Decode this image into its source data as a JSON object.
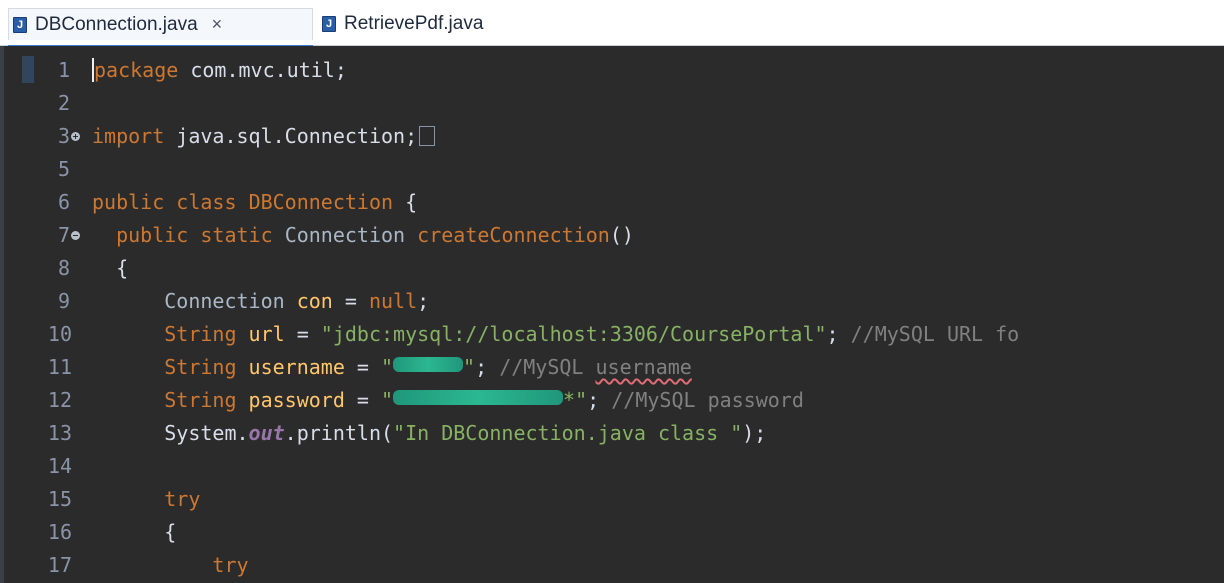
{
  "tabs": [
    {
      "label": "DBConnection.java",
      "icon": "java-file-icon",
      "active": true,
      "close": "×"
    },
    {
      "label": "RetrievePdf.java",
      "icon": "java-file-icon",
      "active": false
    }
  ],
  "editor": {
    "lines": [
      {
        "n": "1",
        "parts": [
          [
            "kw",
            "package"
          ],
          [
            "pln",
            " com.mvc.util;"
          ]
        ]
      },
      {
        "n": "2",
        "parts": []
      },
      {
        "n": "3",
        "fold": "plus",
        "parts": [
          [
            "kw",
            "import"
          ],
          [
            "pln",
            " java.sql.Connection;"
          ]
        ],
        "collapsed": true
      },
      {
        "n": "5",
        "parts": []
      },
      {
        "n": "6",
        "parts": [
          [
            "kw",
            "public"
          ],
          [
            "pln",
            " "
          ],
          [
            "kw",
            "class"
          ],
          [
            "pln",
            " "
          ],
          [
            "kw",
            "DBConnection"
          ],
          [
            "pln",
            " {"
          ]
        ]
      },
      {
        "n": "7",
        "fold": "minus",
        "parts": [
          [
            "pln",
            "  "
          ],
          [
            "kw",
            "public"
          ],
          [
            "pln",
            " "
          ],
          [
            "kw",
            "static"
          ],
          [
            "pln",
            " "
          ],
          [
            "cls",
            "Connection"
          ],
          [
            "pln",
            " "
          ],
          [
            "kw",
            "createConnection"
          ],
          [
            "pln",
            "()"
          ]
        ]
      },
      {
        "n": "8",
        "parts": [
          [
            "pln",
            "  {"
          ]
        ]
      },
      {
        "n": "9",
        "parts": [
          [
            "pln",
            "      "
          ],
          [
            "cls",
            "Connection"
          ],
          [
            "pln",
            " "
          ],
          [
            "ptr",
            "con"
          ],
          [
            "pln",
            " = "
          ],
          [
            "kw",
            "null"
          ],
          [
            "pln",
            ";"
          ]
        ]
      },
      {
        "n": "10",
        "parts": [
          [
            "pln",
            "      "
          ],
          [
            "kw",
            "String"
          ],
          [
            "pln",
            " "
          ],
          [
            "ptr",
            "url"
          ],
          [
            "pln",
            " = "
          ],
          [
            "str",
            "\"jdbc:mysql://localhost:3306/CoursePortal\""
          ],
          [
            "pln",
            "; "
          ],
          [
            "cm",
            "//MySQL URL fo"
          ]
        ]
      },
      {
        "n": "11",
        "parts": [
          [
            "pln",
            "      "
          ],
          [
            "kw",
            "String"
          ],
          [
            "pln",
            " "
          ],
          [
            "ptr",
            "username"
          ],
          [
            "pln",
            " = "
          ],
          [
            "str",
            "\""
          ],
          [
            "redact",
            "70"
          ],
          [
            "str",
            "\""
          ],
          [
            "pln",
            "; "
          ],
          [
            "cm",
            "//MySQL "
          ],
          [
            "cm squiggle",
            "username"
          ]
        ]
      },
      {
        "n": "12",
        "parts": [
          [
            "pln",
            "      "
          ],
          [
            "kw",
            "String"
          ],
          [
            "pln",
            " "
          ],
          [
            "ptr",
            "password"
          ],
          [
            "pln",
            " = "
          ],
          [
            "str",
            "\""
          ],
          [
            "redact",
            "170"
          ],
          [
            "str",
            "*\""
          ],
          [
            "pln",
            "; "
          ],
          [
            "cm",
            "//MySQL password"
          ]
        ]
      },
      {
        "n": "13",
        "parts": [
          [
            "pln",
            "      System."
          ],
          [
            "fld",
            "out"
          ],
          [
            "pln",
            ".println("
          ],
          [
            "str",
            "\"In DBConnection.java class \""
          ],
          [
            "pln",
            ");"
          ]
        ]
      },
      {
        "n": "14",
        "parts": []
      },
      {
        "n": "15",
        "parts": [
          [
            "pln",
            "      "
          ],
          [
            "kw",
            "try"
          ]
        ]
      },
      {
        "n": "16",
        "parts": [
          [
            "pln",
            "      {"
          ]
        ]
      },
      {
        "n": "17",
        "parts": [
          [
            "pln",
            "          "
          ],
          [
            "kw",
            "try"
          ]
        ]
      }
    ]
  }
}
